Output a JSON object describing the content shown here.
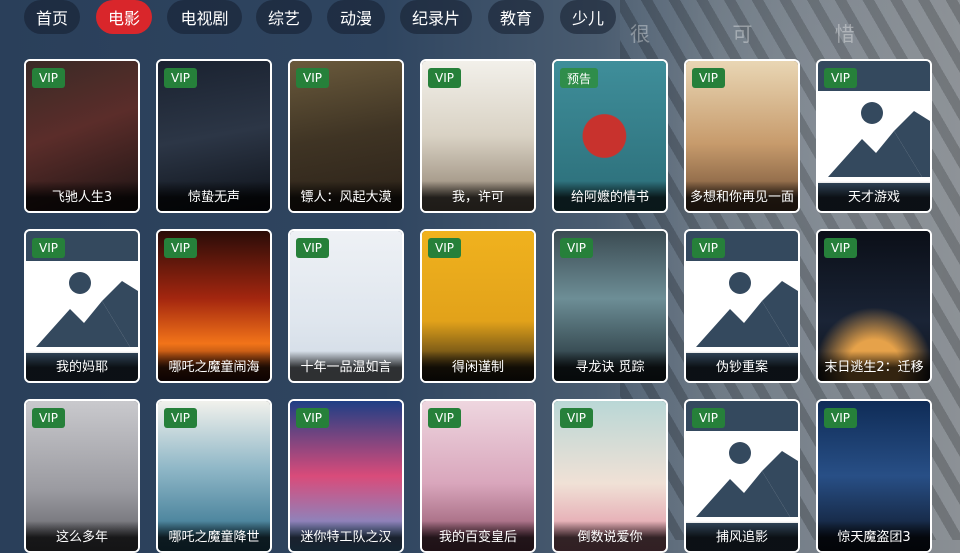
{
  "background": {
    "caption": "很 可 惜"
  },
  "tabs": [
    {
      "label": "首页",
      "active": false
    },
    {
      "label": "电影",
      "active": true
    },
    {
      "label": "电视剧",
      "active": false
    },
    {
      "label": "综艺",
      "active": false
    },
    {
      "label": "动漫",
      "active": false
    },
    {
      "label": "纪录片",
      "active": false
    },
    {
      "label": "教育",
      "active": false
    },
    {
      "label": "少儿",
      "active": false
    }
  ],
  "colors": {
    "active_tab": "#d9262b",
    "badge": "#26803a",
    "card_border": "#ffffff"
  },
  "movies": [
    {
      "title": "飞驰人生3",
      "badge": "VIP",
      "poster": "dark-red"
    },
    {
      "title": "惊蛰无声",
      "badge": "VIP",
      "poster": "dark-blue"
    },
    {
      "title": "镖人：风起大漠",
      "badge": "VIP",
      "poster": "sepia"
    },
    {
      "title": "我，许可",
      "badge": "VIP",
      "poster": "light"
    },
    {
      "title": "给阿嬷的情书",
      "badge": "预告",
      "poster": "teal-red"
    },
    {
      "title": "多想和你再见一面",
      "badge": "VIP",
      "poster": "warm"
    },
    {
      "title": "天才游戏",
      "badge": "VIP",
      "poster": "placeholder"
    },
    {
      "title": "我的妈耶",
      "badge": "VIP",
      "poster": "placeholder"
    },
    {
      "title": "哪吒之魔童闹海",
      "badge": "VIP",
      "poster": "fire"
    },
    {
      "title": "十年一品温如言",
      "badge": "VIP",
      "poster": "pale"
    },
    {
      "title": "得闲谨制",
      "badge": "VIP",
      "poster": "yellow"
    },
    {
      "title": "寻龙诀 觅踪",
      "badge": "VIP",
      "poster": "ice"
    },
    {
      "title": "伪钞重案",
      "badge": "VIP",
      "poster": "placeholder"
    },
    {
      "title": "末日逃生2：迁移",
      "badge": "VIP",
      "poster": "space"
    },
    {
      "title": "这么多年",
      "badge": "VIP",
      "poster": "grey"
    },
    {
      "title": "哪吒之魔童降世",
      "badge": "VIP",
      "poster": "sea"
    },
    {
      "title": "迷你特工队之汉",
      "badge": "VIP",
      "poster": "cartoon"
    },
    {
      "title": "我的百变皇后",
      "badge": "VIP",
      "poster": "pink"
    },
    {
      "title": "倒数说爱你",
      "badge": "VIP",
      "poster": "green-pink"
    },
    {
      "title": "捕风追影",
      "badge": "VIP",
      "poster": "placeholder"
    },
    {
      "title": "惊天魔盗团3",
      "badge": "VIP",
      "poster": "blue-dark"
    }
  ]
}
